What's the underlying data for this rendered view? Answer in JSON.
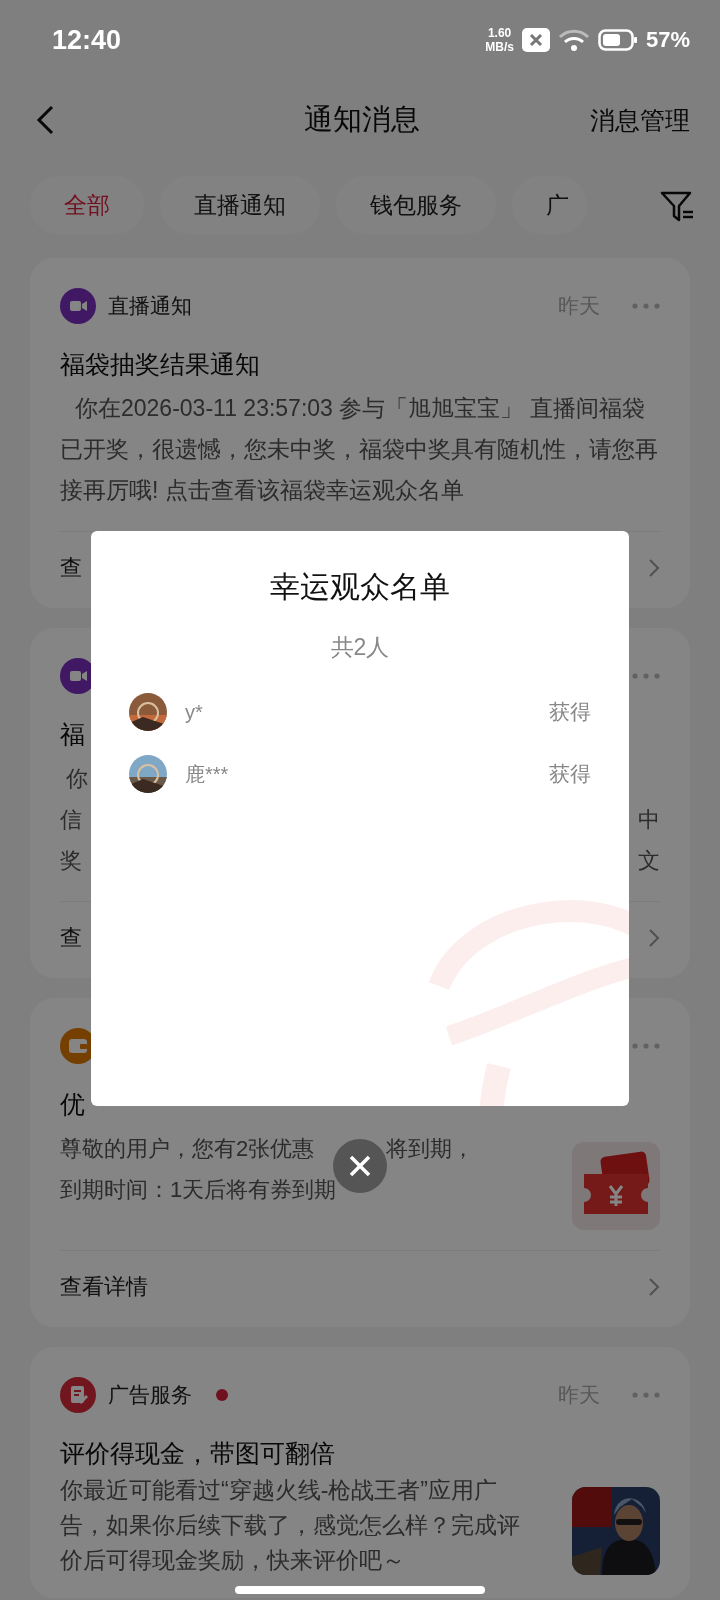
{
  "status_bar": {
    "time": "12:40",
    "net_speed_value": "1.60",
    "net_speed_unit": "MB/s",
    "battery": "57%"
  },
  "header": {
    "title": "通知消息",
    "action": "消息管理"
  },
  "tabs": [
    {
      "label": "全部",
      "selected": true
    },
    {
      "label": "直播通知",
      "selected": false
    },
    {
      "label": "钱包服务",
      "selected": false
    },
    {
      "label": "广",
      "selected": false
    }
  ],
  "notifications": [
    {
      "kind": "live",
      "category": "直播通知",
      "unread": false,
      "time": "昨天",
      "title": "福袋抽奖结果通知",
      "body": "你在2026-03-11 23:57:03 参与「旭旭宝宝」 直播间福袋已开奖，很遗憾，您未中奖，福袋中奖具有随机性，请您再接再厉哦! 点击查看该福袋幸运观众名单",
      "footer": "查"
    },
    {
      "kind": "live_covered",
      "title": "福",
      "body_lines": [
        [
          "你"
        ],
        [
          "信",
          "中"
        ],
        [
          "奖",
          "文"
        ]
      ],
      "footer": "查"
    },
    {
      "kind": "wallet",
      "unread": false,
      "title": "优",
      "body_lines": [
        [
          "尊敬的用户，您有2张优惠",
          "将到期，"
        ],
        [
          "到期时间：1天后将有券到期"
        ]
      ],
      "footer": "查看详情"
    },
    {
      "kind": "ad",
      "category": "广告服务",
      "unread": true,
      "time": "昨天",
      "title": "评价得现金，带图可翻倍",
      "body": "你最近可能看过“穿越火线-枪战王者”应用广告，如果你后续下载了，感觉怎么样？完成评价后可得现金奖励，快来评价吧～"
    }
  ],
  "dialog": {
    "title": "幸运观众名单",
    "count": "共2人",
    "winners": [
      {
        "name": "y*",
        "status": "获得"
      },
      {
        "name": "鹿***",
        "status": "获得"
      }
    ]
  }
}
